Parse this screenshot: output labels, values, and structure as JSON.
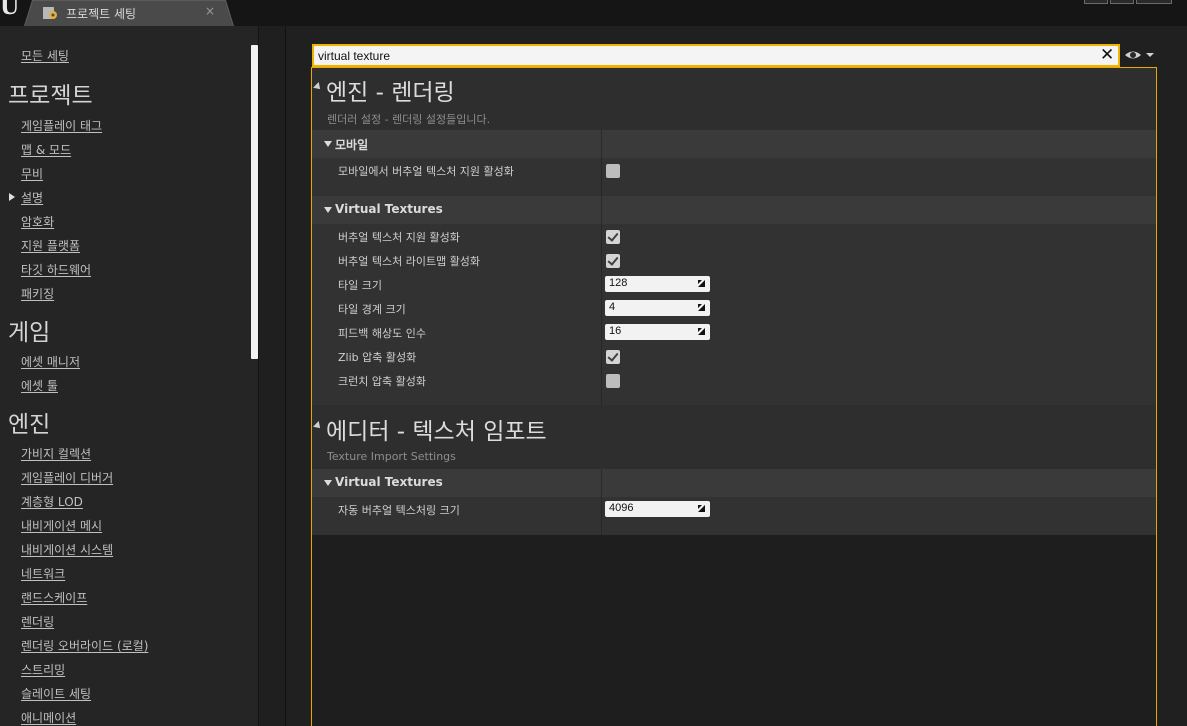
{
  "tab": {
    "label": "프로젝트 세팅",
    "close": "×"
  },
  "logo": "U",
  "sidebar": {
    "all_settings": "모든 세팅",
    "groups": [
      {
        "title": "프로젝트",
        "items": [
          "게임플레이 태그",
          "맵 & 모드",
          "무비",
          "설명",
          "암호화",
          "지원 플랫폼",
          "타깃 하드웨어",
          "패키징"
        ]
      },
      {
        "title": "게임",
        "items": [
          "에셋 매니저",
          "에셋 툴"
        ]
      },
      {
        "title": "엔진",
        "items": [
          "가비지 컬렉션",
          "게임플레이 디버거",
          "계층형 LOD",
          "내비게이션 메시",
          "내비게이션 시스템",
          "네트워크",
          "랜드스케이프",
          "렌더링",
          "렌더링 오버라이드 (로컬)",
          "스트리밍",
          "슬레이트 세팅",
          "애니메이션"
        ]
      }
    ]
  },
  "search": {
    "value": "virtual texture",
    "clear": "✕"
  },
  "sections": [
    {
      "title": "엔진 - 렌더링",
      "subtitle": "렌더러 설정 - 렌더링 설정들입니다.",
      "categories": [
        {
          "name": "모바일",
          "props": [
            {
              "label": "모바일에서 버추얼 텍스처 지원 활성화",
              "kind": "checkbox",
              "checked": false
            }
          ]
        },
        {
          "name": "Virtual Textures",
          "props": [
            {
              "label": "버추얼 텍스처 지원 활성화",
              "kind": "checkbox",
              "checked": true
            },
            {
              "label": "버추얼 텍스처 라이트맵 활성화",
              "kind": "checkbox",
              "checked": true
            },
            {
              "label": "타일 크기",
              "kind": "number",
              "value": "128"
            },
            {
              "label": "타일 경계 크기",
              "kind": "number",
              "value": "4"
            },
            {
              "label": "피드백 해상도 인수",
              "kind": "number",
              "value": "16"
            },
            {
              "label": "Zlib 압축 활성화",
              "kind": "checkbox",
              "checked": true
            },
            {
              "label": "크런치 압축 활성화",
              "kind": "checkbox",
              "checked": false
            }
          ]
        }
      ]
    },
    {
      "title": "에디터 - 텍스처 임포트",
      "subtitle": "Texture Import Settings",
      "categories": [
        {
          "name": "Virtual Textures",
          "props": [
            {
              "label": "자동 버추얼 텍스처링 크기",
              "kind": "number",
              "value": "4096"
            }
          ]
        }
      ]
    }
  ],
  "colors": {
    "accent": "#f0b400",
    "panel_border": "#e8a800",
    "background": "#202020"
  }
}
